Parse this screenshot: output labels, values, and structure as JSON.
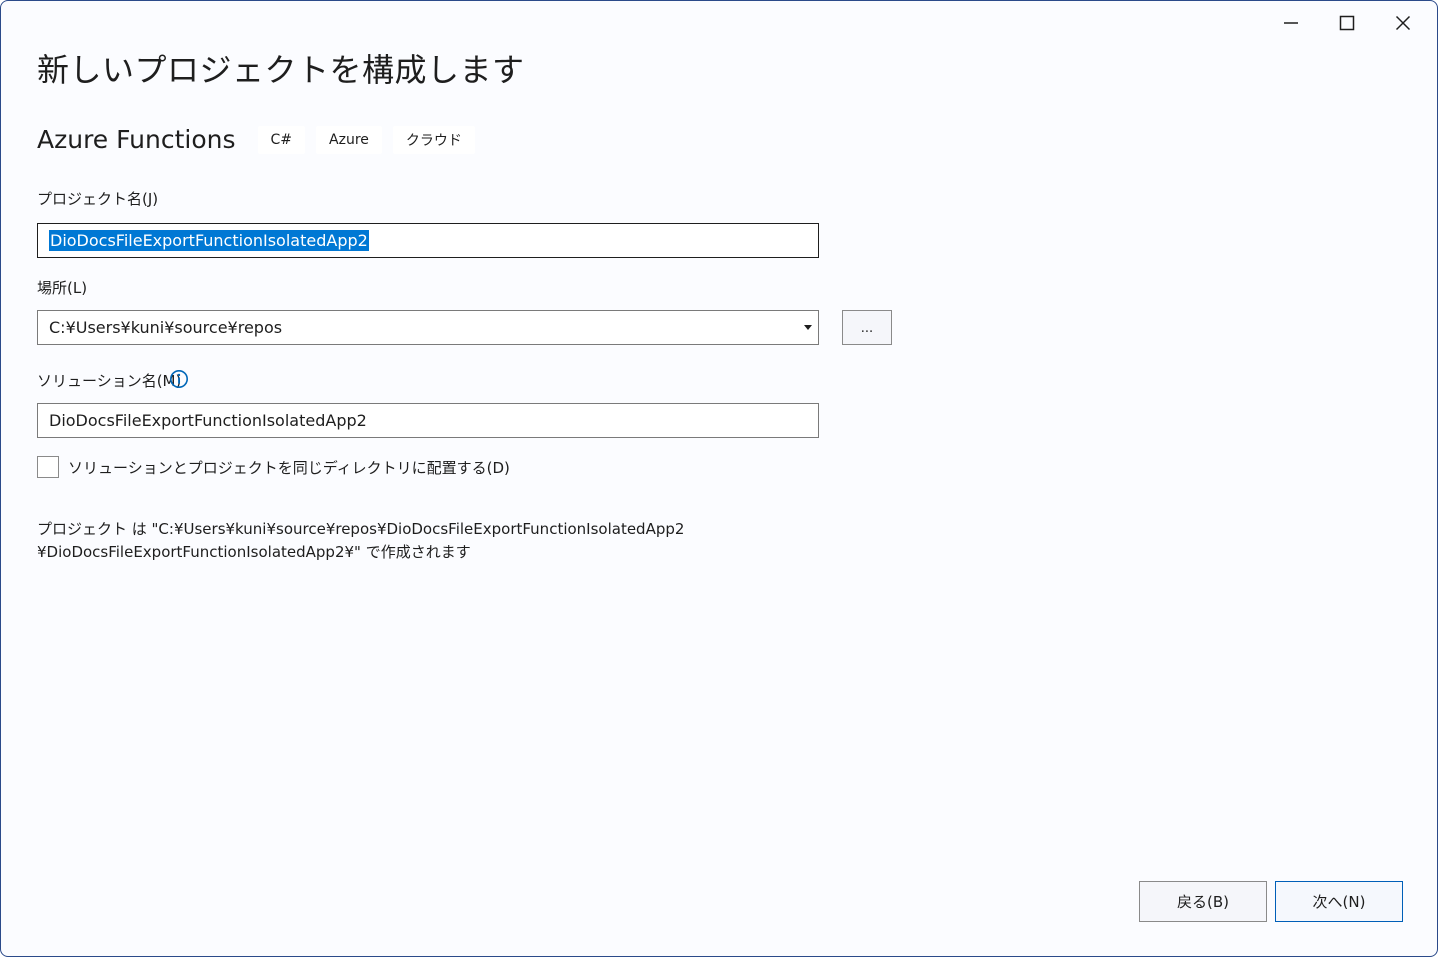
{
  "window": {
    "title": "新しいプロジェクトを構成します"
  },
  "template": {
    "name": "Azure Functions",
    "tags": [
      "C#",
      "Azure",
      "クラウド"
    ]
  },
  "project_name": {
    "label": "プロジェクト名(J)",
    "value": "DioDocsFileExportFunctionIsolatedApp2"
  },
  "location": {
    "label": "場所(L)",
    "value": "C:¥Users¥kuni¥source¥repos",
    "browse_label": "..."
  },
  "solution_name": {
    "label": "ソリューション名(M)",
    "value": "DioDocsFileExportFunctionIsolatedApp2"
  },
  "same_directory": {
    "label": "ソリューションとプロジェクトを同じディレクトリに配置する(D)",
    "checked": false
  },
  "path_note": {
    "line1": "プロジェクト は \"C:¥Users¥kuni¥source¥repos¥DioDocsFileExportFunctionIsolatedApp2",
    "line2": "¥DioDocsFileExportFunctionIsolatedApp2¥\" で作成されます"
  },
  "footer": {
    "back_label": "戻る(B)",
    "next_label": "次へ(N)"
  },
  "colors": {
    "accent": "#0078d4",
    "info_icon": "#0067b8"
  }
}
